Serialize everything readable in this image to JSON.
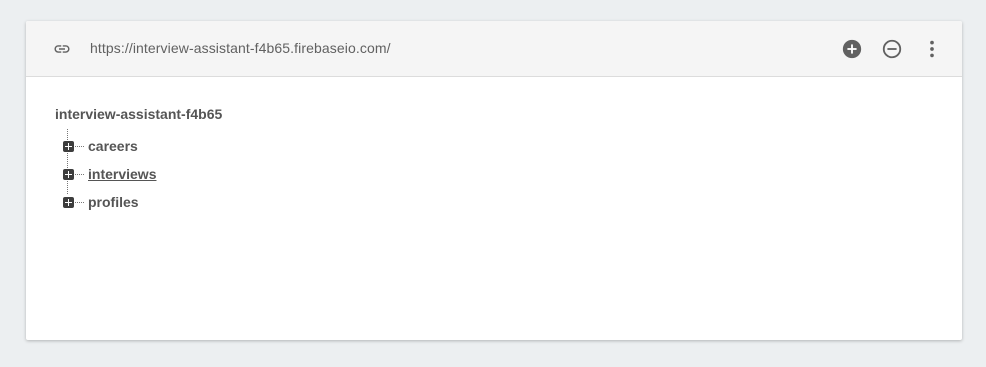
{
  "url_bar": {
    "link_icon": "link-icon",
    "url": "https://interview-assistant-f4b65.firebaseio.com/"
  },
  "actions": [
    {
      "name": "add-icon",
      "icon": "plus-circle-filled"
    },
    {
      "name": "remove-icon",
      "icon": "minus-circle-outline"
    },
    {
      "name": "more-vert-icon",
      "icon": "more-vertical"
    }
  ],
  "tree": {
    "root": "interview-assistant-f4b65",
    "children": [
      {
        "label": "careers",
        "underlined": false
      },
      {
        "label": "interviews",
        "underlined": true
      },
      {
        "label": "profiles",
        "underlined": false
      }
    ]
  },
  "colors": {
    "background": "#eceff1",
    "url_bar_bg": "#f5f5f5",
    "text": "#555555",
    "icon": "#616161"
  }
}
